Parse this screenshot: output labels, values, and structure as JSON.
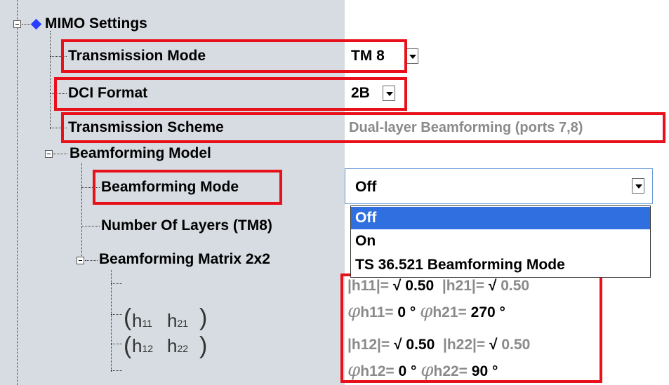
{
  "tree": {
    "mimo_settings": "MIMO Settings",
    "transmission_mode": {
      "label": "Transmission Mode",
      "value": "TM 8"
    },
    "dci_format": {
      "label": "DCI Format",
      "value": "2B"
    },
    "transmission_scheme": {
      "label": "Transmission Scheme",
      "value": "Dual-layer Beamforming (ports 7,8)"
    },
    "beamforming_model": "Beamforming Model",
    "beamforming_mode": {
      "label": "Beamforming Mode",
      "value": "Off"
    },
    "number_of_layers": "Number Of Layers (TM8)",
    "beamforming_matrix": "Beamforming Matrix 2x2"
  },
  "dropdown": {
    "options": [
      "Off",
      "On",
      "TS 36.521 Beamforming Mode"
    ],
    "selected": "Off"
  },
  "matrix_formula": {
    "h11": "h",
    "s11": "11",
    "h21": "h",
    "s21": "21",
    "h12": "h",
    "s12": "12",
    "h22": "h",
    "s22": "22",
    "lparen_top": "(",
    "rparen_top": ")",
    "lparen_bot": "(",
    "rparen_bot": ")"
  },
  "matrix": {
    "row1": {
      "a_label": "|h11|=",
      "a_sqrt": "√",
      "a_val": "0.50",
      "b_label": "|h21|=",
      "b_sqrt": "√",
      "b_val": "0.50"
    },
    "row2": {
      "phi": "φ",
      "a_label": "h11=",
      "a_val": "0 °",
      "phi2": "φ",
      "b_label": "h21=",
      "b_val": "270 °"
    },
    "row3": {
      "a_label": "|h12|=",
      "a_sqrt": "√",
      "a_val": "0.50",
      "b_label": "|h22|=",
      "b_sqrt": "√",
      "b_val": "0.50"
    },
    "row4": {
      "phi": "φ",
      "a_label": "h12=",
      "a_val": "0 °",
      "phi2": "φ",
      "b_label": "h22=",
      "b_val": "90 °"
    }
  },
  "colors": {
    "highlight": "#e8101a",
    "selection": "#2f6fe0",
    "pane": "#d6dce1",
    "diamond": "#2a3cff"
  }
}
